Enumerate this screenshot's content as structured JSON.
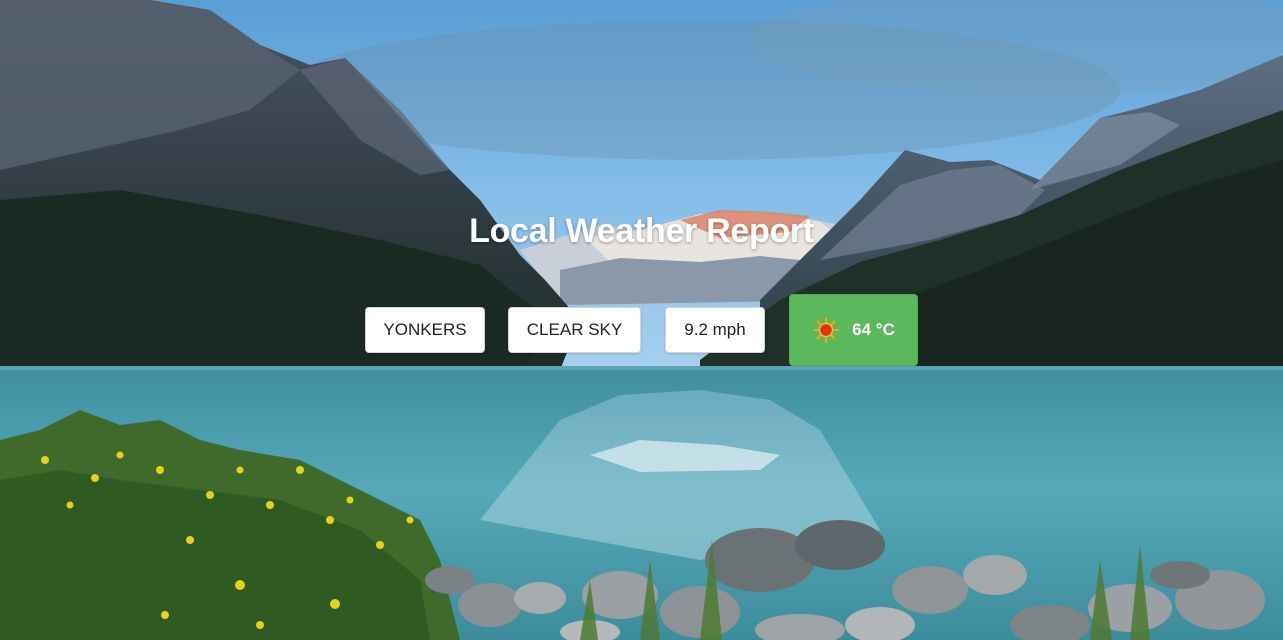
{
  "header": {
    "title": "Local Weather Report"
  },
  "weather": {
    "city": "YONKERS",
    "condition": "CLEAR SKY",
    "wind": "9.2 mph",
    "temperature": "64 °C",
    "condition_icon": "sun-icon"
  },
  "colors": {
    "toggle_button": "#5cb85c",
    "chip_background": "#ffffff",
    "title_text": "#ffffff"
  },
  "background": {
    "scene": "mountain-lake-landscape"
  }
}
